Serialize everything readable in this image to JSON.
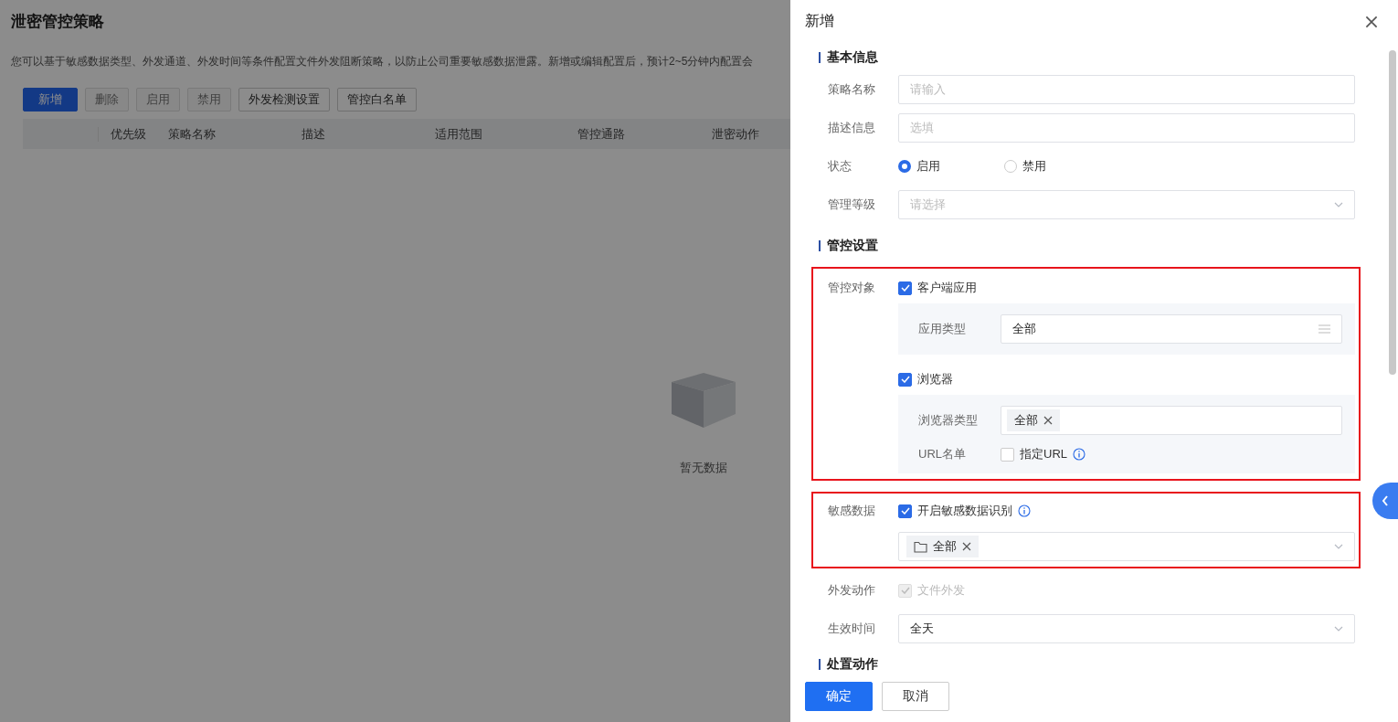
{
  "page": {
    "title": "泄密管控策略",
    "description": "您可以基于敏感数据类型、外发通道、外发时间等条件配置文件外发阻断策略，以防止公司重要敏感数据泄露。新增或编辑配置后，预计2~5分钟内配置会",
    "toolbar": [
      {
        "label": "新增",
        "kind": "primary",
        "disabled": false
      },
      {
        "label": "删除",
        "kind": "default",
        "disabled": true
      },
      {
        "label": "启用",
        "kind": "default",
        "disabled": true
      },
      {
        "label": "禁用",
        "kind": "default",
        "disabled": true
      },
      {
        "label": "外发检测设置",
        "kind": "default",
        "disabled": false
      },
      {
        "label": "管控白名单",
        "kind": "default",
        "disabled": false
      }
    ],
    "columns": [
      "优先级",
      "策略名称",
      "描述",
      "适用范围",
      "管控通路",
      "泄密动作"
    ],
    "empty_text": "暂无数据"
  },
  "drawer": {
    "title": "新增",
    "basic": {
      "heading": "基本信息",
      "fields": [
        {
          "kind": "input",
          "label": "策略名称",
          "placeholder": "请输入"
        },
        {
          "kind": "input",
          "label": "描述信息",
          "placeholder": "选填"
        },
        {
          "kind": "radio",
          "label": "状态",
          "options": [
            {
              "label": "启用",
              "selected": true
            },
            {
              "label": "禁用",
              "selected": false
            }
          ]
        },
        {
          "kind": "select",
          "label": "管理等级",
          "placeholder": "请选择"
        }
      ]
    },
    "control": {
      "heading": "管控设置",
      "control_object": {
        "label": "管控对象",
        "highlighted": true,
        "client_app": {
          "label": "客户端应用",
          "checked": true,
          "app_type": {
            "label": "应用类型",
            "value": "全部"
          }
        },
        "browser": {
          "label": "浏览器",
          "checked": true,
          "browser_type": {
            "label": "浏览器类型",
            "tags": [
              "全部"
            ]
          },
          "url_list": {
            "label": "URL名单",
            "option": {
              "label": "指定URL",
              "checked": false
            }
          }
        }
      },
      "sensitive_data": {
        "label": "敏感数据",
        "highlighted": true,
        "enable": {
          "label": "开启敏感数据识别",
          "checked": true
        },
        "tags": [
          "全部"
        ]
      },
      "send_action": {
        "label": "外发动作",
        "option": {
          "label": "文件外发",
          "checked": true,
          "disabled": true
        }
      },
      "effective_time": {
        "label": "生效时间",
        "value": "全天"
      }
    },
    "next_heading": "处置动作",
    "footer": [
      {
        "label": "确定",
        "kind": "primary"
      },
      {
        "label": "取消",
        "kind": "default"
      }
    ]
  }
}
